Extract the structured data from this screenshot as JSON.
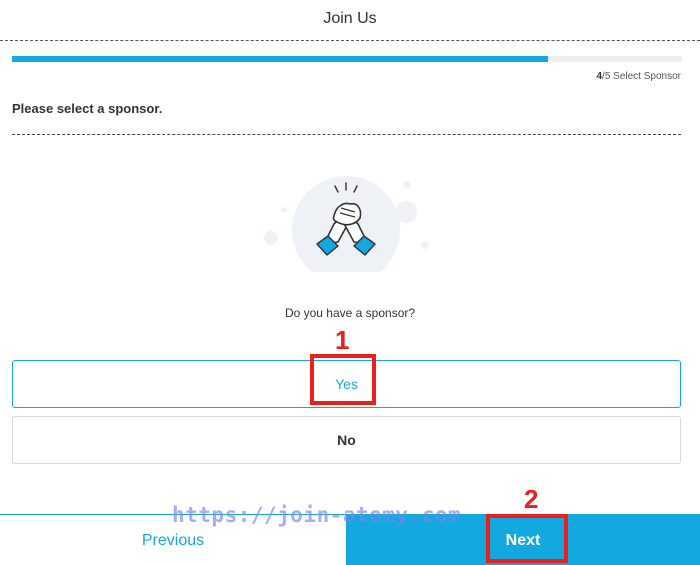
{
  "header": {
    "title": "Join Us"
  },
  "progress": {
    "fraction": 0.8,
    "step_current": "4",
    "step_total": "/5",
    "step_label": "Select Sponsor"
  },
  "section": {
    "title": "Please select a sponsor."
  },
  "illustration": {
    "icon": "handshake-icon",
    "bg_color": "#eef1f5",
    "accent_color": "#13a9e0"
  },
  "question": "Do you have a sponsor?",
  "options": [
    {
      "label": "Yes",
      "selected": true
    },
    {
      "label": "No",
      "selected": false
    }
  ],
  "annotations": {
    "one": "1",
    "two": "2"
  },
  "footer": {
    "previous_label": "Previous",
    "next_label": "Next"
  },
  "watermark": "https://join-atomy.com",
  "colors": {
    "accent": "#13a9e0",
    "annotation": "#e8211c"
  }
}
